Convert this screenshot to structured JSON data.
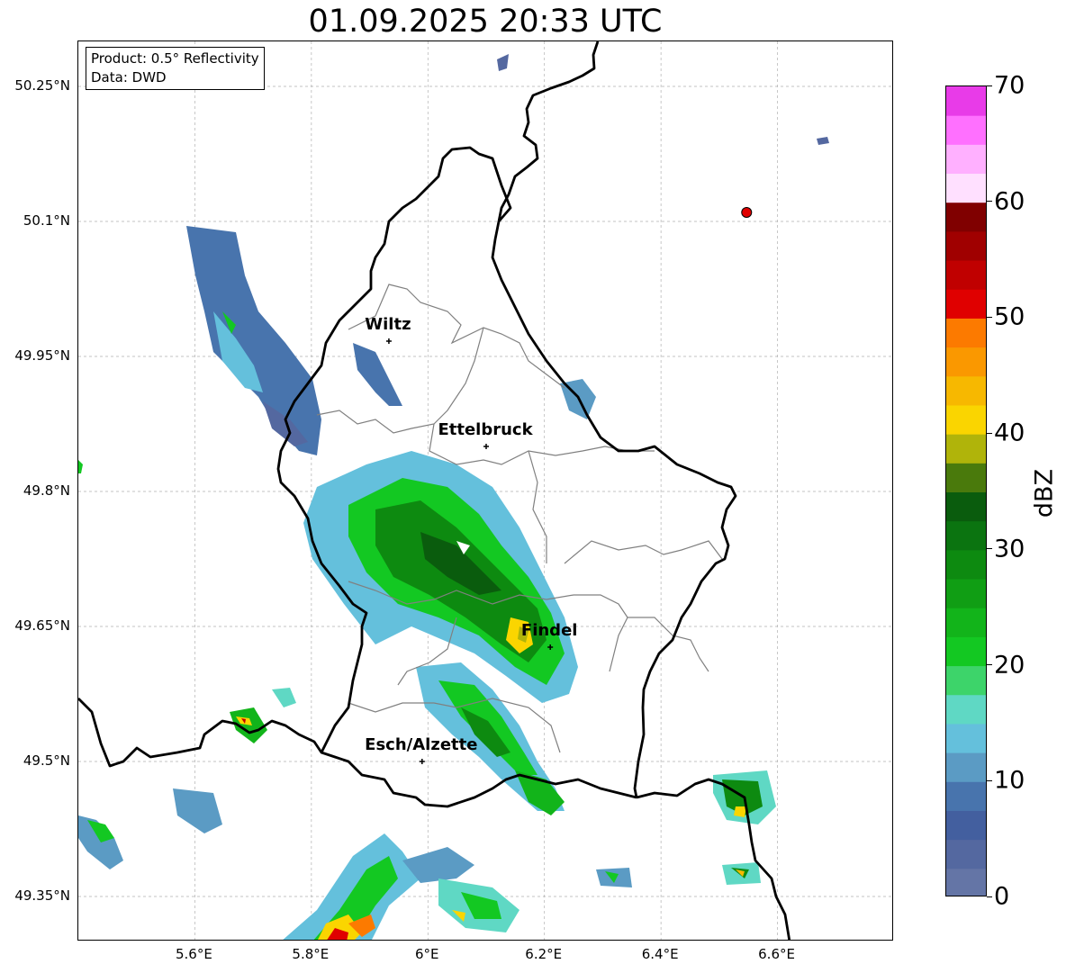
{
  "title": "01.09.2025 20:33 UTC",
  "info_box": {
    "product": "Product: 0.5° Reflectivity",
    "data": "Data: DWD"
  },
  "axes": {
    "lat_ticks": [
      "50.25°N",
      "50.1°N",
      "49.95°N",
      "49.8°N",
      "49.65°N",
      "49.5°N",
      "49.35°N"
    ],
    "lon_ticks": [
      "5.6°E",
      "5.8°E",
      "6°E",
      "6.2°E",
      "6.4°E",
      "6.6°E"
    ],
    "lon_range": [
      5.4,
      6.8
    ],
    "lat_range": [
      49.3,
      50.3
    ],
    "gridlines": true
  },
  "cities": [
    {
      "name": "Wiltz",
      "lon": 5.933,
      "lat": 49.967
    },
    {
      "name": "Ettelbruck",
      "lon": 6.1,
      "lat": 49.85
    },
    {
      "name": "Findel",
      "lon": 6.21,
      "lat": 49.627
    },
    {
      "name": "Esch/Alzette",
      "lon": 5.99,
      "lat": 49.5
    }
  ],
  "marker": {
    "type": "radar-site-dot",
    "lon": 6.547,
    "lat": 50.11,
    "color": "#e00000"
  },
  "colorbar": {
    "label": "dBZ",
    "ticks": [
      "0",
      "10",
      "20",
      "30",
      "40",
      "50",
      "60",
      "70"
    ],
    "min": 0,
    "max": 70,
    "colors": [
      "#6475a6",
      "#5468a0",
      "#435f9f",
      "#4874ad",
      "#5b9bc4",
      "#64c0dc",
      "#5fd8c4",
      "#3dd46a",
      "#13c822",
      "#12b41a",
      "#109e14",
      "#0d8a10",
      "#0b7410",
      "#0a5c0d",
      "#4a7a0c",
      "#b0b40a",
      "#fad500",
      "#f7b800",
      "#fa9800",
      "#fc7a00",
      "#e00000",
      "#c00000",
      "#a00000",
      "#800000",
      "#ffe0ff",
      "#ffb0ff",
      "#ff70ff",
      "#e83be8"
    ]
  },
  "colors": {
    "border": "#000000",
    "cantons": "#808080",
    "grid": "#b0b0b0"
  }
}
